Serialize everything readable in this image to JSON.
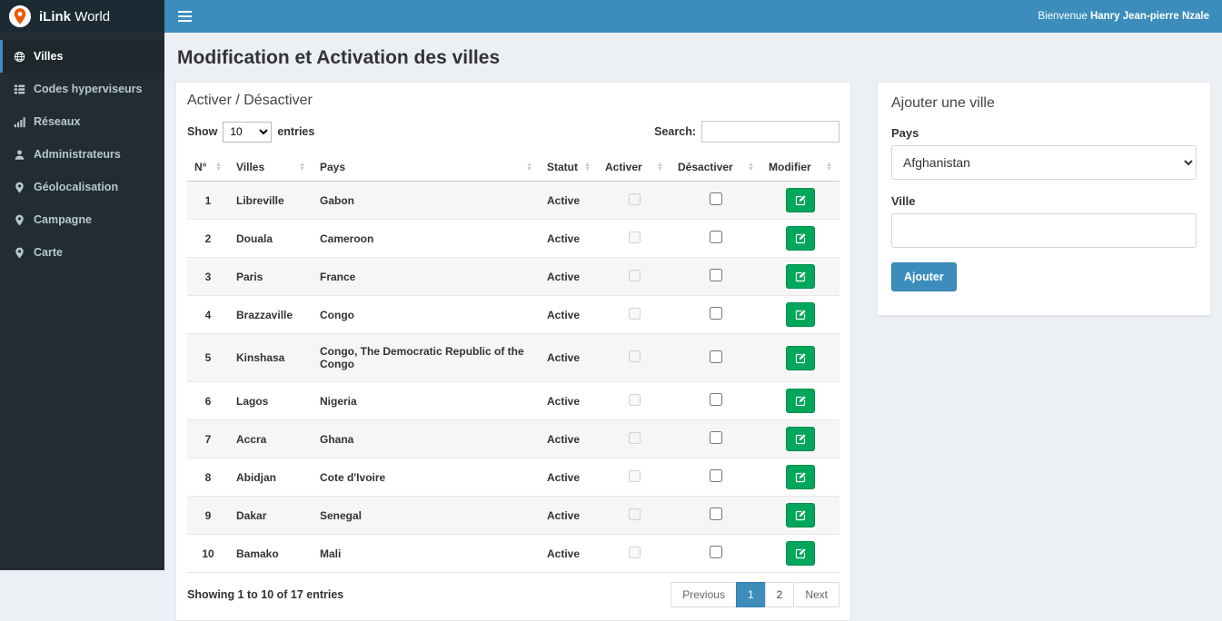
{
  "app": {
    "brand_bold": "iLink",
    "brand_rest": "World",
    "welcome_prefix": "Bienvenue ",
    "welcome_user": "Hanry Jean-pierre Nzale"
  },
  "sidebar": {
    "items": [
      {
        "label": "Villes",
        "icon": "globe",
        "active": true
      },
      {
        "label": "Codes hyperviseurs",
        "icon": "th-list",
        "active": false
      },
      {
        "label": "Réseaux",
        "icon": "signal",
        "active": false
      },
      {
        "label": "Administrateurs",
        "icon": "user",
        "active": false
      },
      {
        "label": "Géolocalisation",
        "icon": "map-marker",
        "active": false
      },
      {
        "label": "Campagne",
        "icon": "map-marker",
        "active": false
      },
      {
        "label": "Carte",
        "icon": "map-marker",
        "active": false
      }
    ]
  },
  "page": {
    "title": "Modification et Activation des villes"
  },
  "table_panel": {
    "title": "Activer / Désactiver",
    "show_label": "Show",
    "entries_label": "entries",
    "page_length": "10",
    "search_label": "Search:",
    "search_value": "",
    "columns": [
      "N°",
      "Villes",
      "Pays",
      "Statut",
      "Activer",
      "Désactiver",
      "Modifier"
    ],
    "rows": [
      {
        "num": "1",
        "ville": "Libreville",
        "pays": "Gabon",
        "statut": "Active"
      },
      {
        "num": "2",
        "ville": "Douala",
        "pays": "Cameroon",
        "statut": "Active"
      },
      {
        "num": "3",
        "ville": "Paris",
        "pays": "France",
        "statut": "Active"
      },
      {
        "num": "4",
        "ville": "Brazzaville",
        "pays": "Congo",
        "statut": "Active"
      },
      {
        "num": "5",
        "ville": "Kinshasa",
        "pays": "Congo, The Democratic Republic of the Congo",
        "statut": "Active"
      },
      {
        "num": "6",
        "ville": "Lagos",
        "pays": "Nigeria",
        "statut": "Active"
      },
      {
        "num": "7",
        "ville": "Accra",
        "pays": "Ghana",
        "statut": "Active"
      },
      {
        "num": "8",
        "ville": "Abidjan",
        "pays": "Cote d'Ivoire",
        "statut": "Active"
      },
      {
        "num": "9",
        "ville": "Dakar",
        "pays": "Senegal",
        "statut": "Active"
      },
      {
        "num": "10",
        "ville": "Bamako",
        "pays": "Mali",
        "statut": "Active"
      }
    ],
    "footer": {
      "info": "Showing 1 to 10 of 17 entries",
      "previous": "Previous",
      "pages": [
        {
          "label": "1",
          "active": true
        },
        {
          "label": "2",
          "active": false
        }
      ],
      "next": "Next"
    }
  },
  "add_panel": {
    "title": "Ajouter une ville",
    "pays_label": "Pays",
    "pays_value": "Afghanistan",
    "ville_label": "Ville",
    "ville_value": "",
    "submit_label": "Ajouter"
  },
  "colors": {
    "header": "#3c8dbc",
    "brand_bg": "#1b2a33",
    "sidebar_bg": "#222d32",
    "success_button": "#00a65a",
    "primary_button": "#3c8dbc",
    "logo_accent": "#e8590c"
  }
}
